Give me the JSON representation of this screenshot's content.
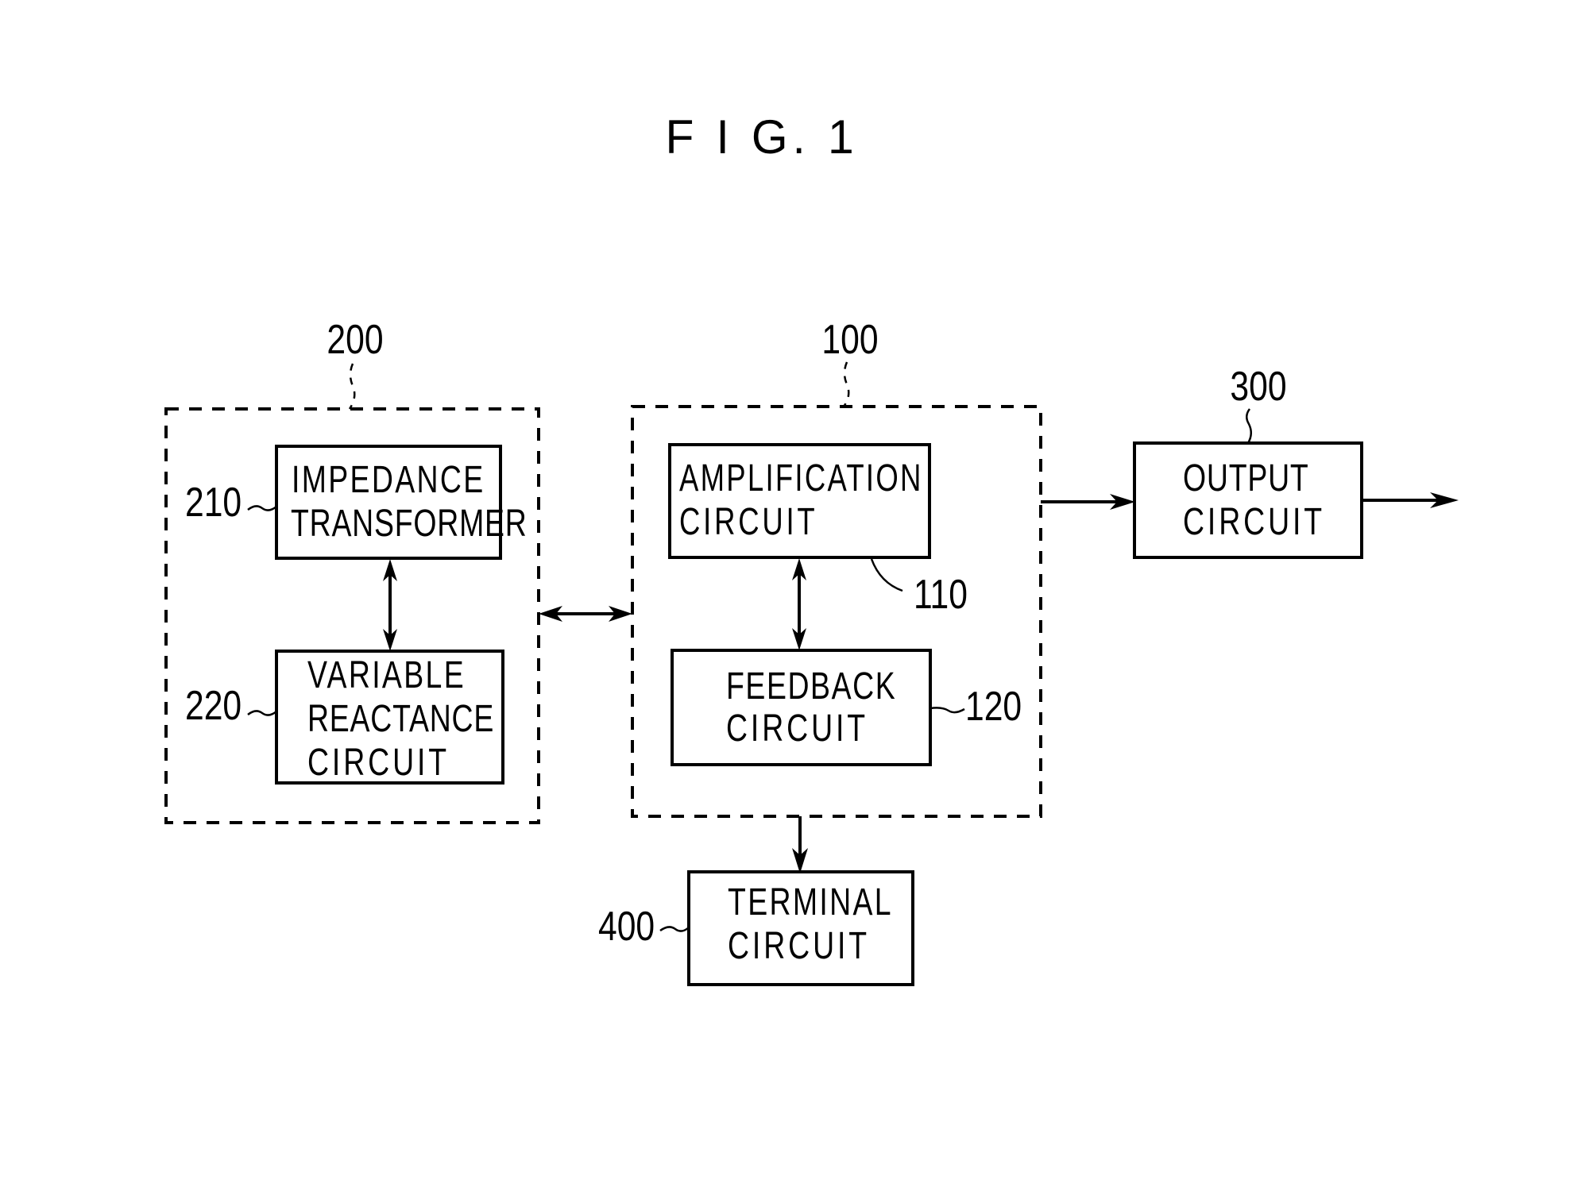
{
  "figure": {
    "title": "F I G. 1",
    "groups": [
      {
        "id": "group-200",
        "ref": "200",
        "description": "dashed group containing impedance transformer and variable reactance circuit"
      },
      {
        "id": "group-100",
        "ref": "100",
        "description": "dashed group containing amplification circuit and feedback circuit"
      }
    ],
    "blocks": [
      {
        "id": "impedance-transformer",
        "ref": "210",
        "lines": [
          "IMPEDANCE",
          "TRANSFORMER"
        ]
      },
      {
        "id": "variable-reactance-circuit",
        "ref": "220",
        "lines": [
          "VARIABLE",
          "REACTANCE",
          "CIRCUIT"
        ]
      },
      {
        "id": "amplification-circuit",
        "ref": "110",
        "lines": [
          "AMPLIFICATION",
          "CIRCUIT"
        ]
      },
      {
        "id": "feedback-circuit",
        "ref": "120",
        "lines": [
          "FEEDBACK",
          "CIRCUIT"
        ]
      },
      {
        "id": "output-circuit",
        "ref": "300",
        "lines": [
          "OUTPUT",
          "CIRCUIT"
        ]
      },
      {
        "id": "terminal-circuit",
        "ref": "400",
        "lines": [
          "TERMINAL",
          "CIRCUIT"
        ]
      }
    ],
    "connections": [
      {
        "from": "210",
        "to": "220",
        "direction": "bidirectional"
      },
      {
        "from": "200",
        "to": "100",
        "direction": "bidirectional"
      },
      {
        "from": "110",
        "to": "120",
        "direction": "bidirectional"
      },
      {
        "from": "100",
        "to": "300",
        "direction": "forward"
      },
      {
        "from": "300",
        "to": "output",
        "direction": "forward"
      },
      {
        "from": "100",
        "to": "400",
        "direction": "forward"
      }
    ]
  }
}
